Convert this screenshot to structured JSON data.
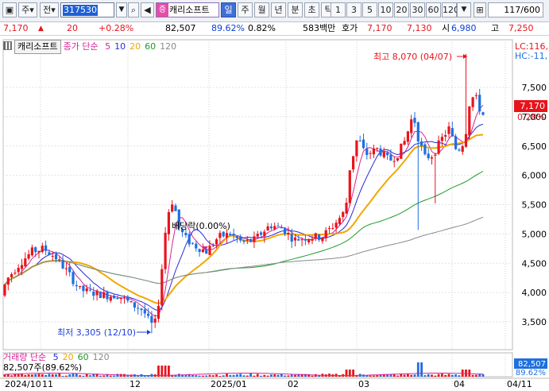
{
  "toolbar": {
    "mode_label": "주",
    "period_label": "전",
    "code": "317530",
    "market_tag": "증",
    "stock_name": "캐리소프트",
    "period_tabs": [
      "일",
      "주",
      "월",
      "년",
      "분",
      "초",
      "틱"
    ],
    "minute_options": [
      "1",
      "3",
      "5",
      "10",
      "20",
      "30",
      "60",
      "120"
    ],
    "page_indicator": "117/600"
  },
  "quote": {
    "price": "7,170",
    "change": "20",
    "change_pct": "+0.28%",
    "volume": "82,507",
    "volume_ratio": "89.62%",
    "turnover_pct": "0.82%",
    "trade_amount": "583백만",
    "ask_label": "호가",
    "ask_price": "7,170",
    "bid_price": "7,130",
    "open_label": "시",
    "open_price": "6,980",
    "high_label": "고",
    "high_price": "7,250"
  },
  "chart_data": {
    "type": "candlestick",
    "stock_name": "캐리소프트",
    "legend_title": "종가 단순",
    "ma_periods": [
      "5",
      "10",
      "20",
      "60",
      "120"
    ],
    "ma_colors": [
      "#d6249a",
      "#2b2bd8",
      "#f0a800",
      "#1f9a2a",
      "#8a8a8a"
    ],
    "up_color": "#e8141c",
    "down_color": "#1e6fe0",
    "y_ticks": [
      "7,500",
      "7,000",
      "6,500",
      "6,000",
      "5,500",
      "5,000",
      "4,500",
      "4,000",
      "3,500"
    ],
    "ylim": [
      3250,
      8200
    ],
    "x_labels": [
      "2024/10",
      "11",
      "12",
      "2025/01",
      "02",
      "03",
      "04",
      "04/11"
    ],
    "last_price_label": "7,170",
    "last_change_label": "0.28%",
    "lc_label": "LC:116,",
    "hc_label": "HC:-11,",
    "annotations": {
      "high": "최고 8,070 (04/07)",
      "low": "최저 3,305 (12/10)",
      "limit": "배당락(0.00%)"
    },
    "volume_legend_title": "거래량 단순",
    "volume_ma_periods": [
      "5",
      "20",
      "60",
      "120"
    ],
    "volume_readout": "82,507주(89.62%)",
    "volume_value_label": "82,507",
    "volume_pct_label": "89.62%"
  }
}
